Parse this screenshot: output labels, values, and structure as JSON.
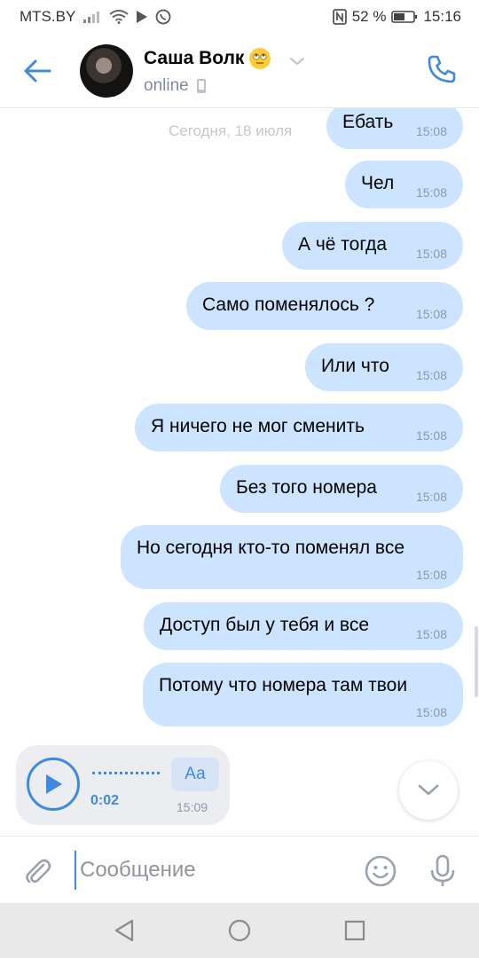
{
  "status_bar": {
    "carrier": "MTS.BY",
    "battery": "52 %",
    "time": "15:16"
  },
  "header": {
    "contact_name": "Саша Волк",
    "status": "online"
  },
  "chat": {
    "date_separator": "Сегодня, 18 июля",
    "messages": [
      {
        "text": "Ебать",
        "time": "15:08"
      },
      {
        "text": "Чел",
        "time": "15:08"
      },
      {
        "text": "А чё тогда",
        "time": "15:08"
      },
      {
        "text": "Само поменялось ?",
        "time": "15:08"
      },
      {
        "text": "Или что",
        "time": "15:08"
      },
      {
        "text": "Я ничего не мог сменить",
        "time": "15:08"
      },
      {
        "text": "Без того номера",
        "time": "15:08"
      },
      {
        "text": "Но сегодня кто-то поменял все",
        "time": "15:08"
      },
      {
        "text": "Доступ был у тебя и все",
        "time": "15:08"
      },
      {
        "text": "Потому что номера там твои",
        "time": "15:08"
      }
    ],
    "voice_message": {
      "duration": "0:02",
      "transcribe_label": "Аа",
      "time": "15:09"
    }
  },
  "composer": {
    "placeholder": "Сообщение"
  },
  "colors": {
    "accent": "#3f8ae0",
    "bubble": "#cce4ff"
  }
}
